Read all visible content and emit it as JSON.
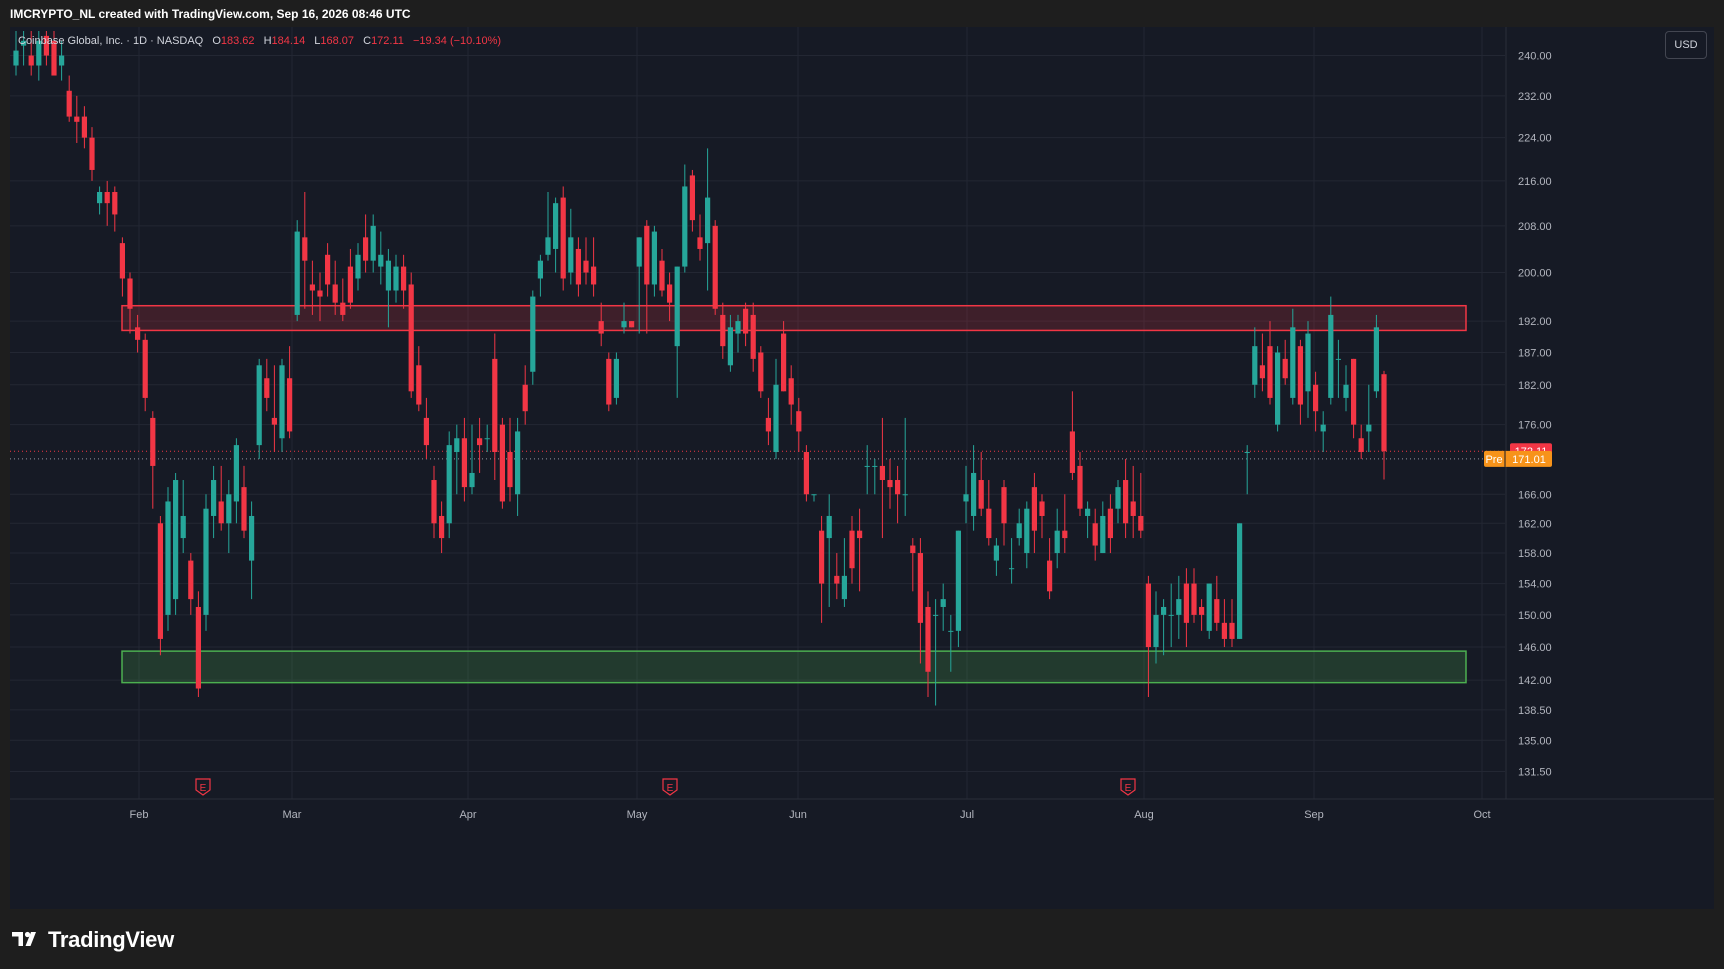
{
  "header": {
    "credit": "IMCRYPTO_NL created with TradingView.com, Sep 16, 2026 08:46 UTC"
  },
  "legend": {
    "symbol": "Coinbase Global, Inc. · 1D · NASDAQ",
    "open_label": "O",
    "open_value": "183.62",
    "high_label": "H",
    "high_value": "184.14",
    "low_label": "L",
    "low_value": "168.07",
    "close_label": "C",
    "close_value": "172.11",
    "change": "−19.34 (−10.10%)"
  },
  "currency_button": "USD",
  "price_tags": {
    "last_price": "172.11",
    "pre_label": "Pre",
    "pre_price": "171.01"
  },
  "footer": {
    "brand": "TradingView"
  },
  "colors": {
    "up": "#26a69a",
    "down": "#f23645",
    "background": "#161a25",
    "resistance_zone": "#f23645",
    "support_zone": "#4caf50",
    "pre_tag": "#f7931a"
  },
  "chart_data": {
    "type": "candlestick",
    "x_tick_labels": [
      "Feb",
      "Mar",
      "Apr",
      "May",
      "Jun",
      "Jul",
      "Aug",
      "Sep",
      "Oct"
    ],
    "y_tick_labels": [
      "240.00",
      "232.00",
      "224.00",
      "216.00",
      "208.00",
      "200.00",
      "192.00",
      "187.00",
      "182.00",
      "176.00",
      "166.00",
      "162.00",
      "158.00",
      "154.00",
      "150.00",
      "146.00",
      "142.00",
      "138.50",
      "135.00",
      "131.50"
    ],
    "y_scale": "log",
    "ylim": [
      128.5,
      245
    ],
    "zones": [
      {
        "kind": "resistance",
        "from": "Feb",
        "to": "Sep",
        "low": 190.5,
        "high": 194.5
      },
      {
        "kind": "support",
        "from": "Feb",
        "to": "Sep",
        "low": 141.7,
        "high": 145.5
      }
    ],
    "earnings_markers": [
      "Feb",
      "May",
      "Aug"
    ],
    "earnings_marker_label": "E",
    "last_close": 172.11,
    "premarket": 171.01,
    "candles": [
      {
        "o": 238,
        "h": 245,
        "l": 236,
        "c": 241
      },
      {
        "o": 242,
        "h": 245,
        "l": 238,
        "c": 243
      },
      {
        "o": 240,
        "h": 245,
        "l": 236,
        "c": 238
      },
      {
        "o": 238,
        "h": 245,
        "l": 235,
        "c": 243
      },
      {
        "o": 244,
        "h": 245,
        "l": 238,
        "c": 240
      },
      {
        "o": 243,
        "h": 245,
        "l": 236,
        "c": 236
      },
      {
        "o": 238,
        "h": 243,
        "l": 235,
        "c": 240
      },
      {
        "o": 233,
        "h": 236,
        "l": 227,
        "c": 228
      },
      {
        "o": 228,
        "h": 232,
        "l": 223,
        "c": 227
      },
      {
        "o": 228,
        "h": 230,
        "l": 222,
        "c": 224
      },
      {
        "o": 224,
        "h": 226,
        "l": 216,
        "c": 218
      },
      {
        "o": 212,
        "h": 215,
        "l": 210,
        "c": 214
      },
      {
        "o": 214,
        "h": 216,
        "l": 208,
        "c": 212
      },
      {
        "o": 214,
        "h": 215,
        "l": 207,
        "c": 210
      },
      {
        "o": 205,
        "h": 206,
        "l": 196,
        "c": 199
      },
      {
        "o": 199,
        "h": 200,
        "l": 190,
        "c": 194
      },
      {
        "o": 191,
        "h": 193,
        "l": 187,
        "c": 189
      },
      {
        "o": 189,
        "h": 190,
        "l": 178,
        "c": 180
      },
      {
        "o": 177,
        "h": 178,
        "l": 164,
        "c": 170
      },
      {
        "o": 162,
        "h": 163,
        "l": 145,
        "c": 147
      },
      {
        "o": 150,
        "h": 167,
        "l": 148,
        "c": 165
      },
      {
        "o": 152,
        "h": 169,
        "l": 150,
        "c": 168
      },
      {
        "o": 160,
        "h": 168,
        "l": 158,
        "c": 163
      },
      {
        "o": 157,
        "h": 158,
        "l": 150,
        "c": 152
      },
      {
        "o": 151,
        "h": 153,
        "l": 140,
        "c": 141
      },
      {
        "o": 150,
        "h": 166,
        "l": 148,
        "c": 164
      },
      {
        "o": 163,
        "h": 170,
        "l": 160,
        "c": 168
      },
      {
        "o": 165,
        "h": 170,
        "l": 161,
        "c": 162
      },
      {
        "o": 162,
        "h": 168,
        "l": 158,
        "c": 166
      },
      {
        "o": 165,
        "h": 174,
        "l": 162,
        "c": 173
      },
      {
        "o": 167,
        "h": 170,
        "l": 160,
        "c": 161
      },
      {
        "o": 157,
        "h": 165,
        "l": 152,
        "c": 163
      },
      {
        "o": 173,
        "h": 186,
        "l": 171,
        "c": 185
      },
      {
        "o": 183,
        "h": 186,
        "l": 178,
        "c": 180
      },
      {
        "o": 177,
        "h": 185,
        "l": 172,
        "c": 176
      },
      {
        "o": 174,
        "h": 186,
        "l": 172,
        "c": 185
      },
      {
        "o": 183,
        "h": 188,
        "l": 174,
        "c": 175
      },
      {
        "o": 193,
        "h": 209,
        "l": 192,
        "c": 207
      },
      {
        "o": 206,
        "h": 214,
        "l": 194,
        "c": 202
      },
      {
        "o": 198,
        "h": 202,
        "l": 193,
        "c": 197
      },
      {
        "o": 197,
        "h": 200,
        "l": 192,
        "c": 196
      },
      {
        "o": 203,
        "h": 205,
        "l": 196,
        "c": 198
      },
      {
        "o": 198,
        "h": 202,
        "l": 193,
        "c": 195
      },
      {
        "o": 195,
        "h": 199,
        "l": 192,
        "c": 193
      },
      {
        "o": 201,
        "h": 204,
        "l": 194,
        "c": 195
      },
      {
        "o": 199,
        "h": 205,
        "l": 197,
        "c": 203
      },
      {
        "o": 206,
        "h": 210,
        "l": 200,
        "c": 202
      },
      {
        "o": 202,
        "h": 210,
        "l": 200,
        "c": 208
      },
      {
        "o": 201,
        "h": 207,
        "l": 198,
        "c": 203
      },
      {
        "o": 197,
        "h": 204,
        "l": 191,
        "c": 202
      },
      {
        "o": 197,
        "h": 203,
        "l": 195,
        "c": 201
      },
      {
        "o": 201,
        "h": 203,
        "l": 194,
        "c": 197
      },
      {
        "o": 198,
        "h": 200,
        "l": 180,
        "c": 181
      },
      {
        "o": 185,
        "h": 188,
        "l": 178,
        "c": 179
      },
      {
        "o": 177,
        "h": 180,
        "l": 171,
        "c": 173
      },
      {
        "o": 168,
        "h": 170,
        "l": 160,
        "c": 162
      },
      {
        "o": 163,
        "h": 165,
        "l": 158,
        "c": 160
      },
      {
        "o": 162,
        "h": 175,
        "l": 160,
        "c": 173
      },
      {
        "o": 172,
        "h": 176,
        "l": 166,
        "c": 174
      },
      {
        "o": 174,
        "h": 177,
        "l": 165,
        "c": 167
      },
      {
        "o": 167,
        "h": 176,
        "l": 166,
        "c": 169
      },
      {
        "o": 174,
        "h": 177,
        "l": 169,
        "c": 173
      },
      {
        "o": 174,
        "h": 176,
        "l": 172,
        "c": 174
      },
      {
        "o": 186,
        "h": 190,
        "l": 168,
        "c": 172
      },
      {
        "o": 176,
        "h": 177,
        "l": 164,
        "c": 165
      },
      {
        "o": 172,
        "h": 177,
        "l": 165,
        "c": 167
      },
      {
        "o": 166,
        "h": 177,
        "l": 163,
        "c": 175
      },
      {
        "o": 182,
        "h": 185,
        "l": 176,
        "c": 178
      },
      {
        "o": 184,
        "h": 197,
        "l": 182,
        "c": 196
      },
      {
        "o": 199,
        "h": 203,
        "l": 196,
        "c": 202
      },
      {
        "o": 203,
        "h": 214,
        "l": 202,
        "c": 206
      },
      {
        "o": 204,
        "h": 213,
        "l": 200,
        "c": 212
      },
      {
        "o": 213,
        "h": 215,
        "l": 197,
        "c": 199
      },
      {
        "o": 200,
        "h": 211,
        "l": 198,
        "c": 206
      },
      {
        "o": 204,
        "h": 206,
        "l": 196,
        "c": 198
      },
      {
        "o": 202,
        "h": 206,
        "l": 198,
        "c": 200
      },
      {
        "o": 201,
        "h": 206,
        "l": 196,
        "c": 198
      },
      {
        "o": 192,
        "h": 195,
        "l": 188,
        "c": 190
      },
      {
        "o": 186,
        "h": 187,
        "l": 178,
        "c": 179
      },
      {
        "o": 180,
        "h": 187,
        "l": 179,
        "c": 186
      },
      {
        "o": 191,
        "h": 195,
        "l": 190,
        "c": 192
      },
      {
        "o": 192,
        "h": 192,
        "l": 191,
        "c": 191
      },
      {
        "o": 201,
        "h": 206,
        "l": 190,
        "c": 206
      },
      {
        "o": 208,
        "h": 209,
        "l": 190,
        "c": 198
      },
      {
        "o": 198,
        "h": 208,
        "l": 196,
        "c": 207
      },
      {
        "o": 202,
        "h": 204,
        "l": 196,
        "c": 197
      },
      {
        "o": 198,
        "h": 200,
        "l": 192,
        "c": 195
      },
      {
        "o": 188,
        "h": 201,
        "l": 180,
        "c": 201
      },
      {
        "o": 201,
        "h": 219,
        "l": 200,
        "c": 215
      },
      {
        "o": 217,
        "h": 218,
        "l": 207,
        "c": 209
      },
      {
        "o": 206,
        "h": 210,
        "l": 202,
        "c": 204
      },
      {
        "o": 205,
        "h": 222,
        "l": 197,
        "c": 213
      },
      {
        "o": 208,
        "h": 209,
        "l": 193,
        "c": 194
      },
      {
        "o": 193,
        "h": 195,
        "l": 186,
        "c": 188
      },
      {
        "o": 185,
        "h": 193,
        "l": 184,
        "c": 191
      },
      {
        "o": 190,
        "h": 193,
        "l": 187,
        "c": 192
      },
      {
        "o": 194,
        "h": 195,
        "l": 188,
        "c": 190
      },
      {
        "o": 193,
        "h": 195,
        "l": 184,
        "c": 186
      },
      {
        "o": 187,
        "h": 188,
        "l": 180,
        "c": 181
      },
      {
        "o": 177,
        "h": 180,
        "l": 173,
        "c": 175
      },
      {
        "o": 172,
        "h": 186,
        "l": 171,
        "c": 182
      },
      {
        "o": 190,
        "h": 192,
        "l": 181,
        "c": 181
      },
      {
        "o": 183,
        "h": 185,
        "l": 176,
        "c": 179
      },
      {
        "o": 178,
        "h": 180,
        "l": 172,
        "c": 175
      },
      {
        "o": 172,
        "h": 173,
        "l": 165,
        "c": 166
      },
      {
        "o": 166,
        "h": 166,
        "l": 165,
        "c": 166
      },
      {
        "o": 161,
        "h": 163,
        "l": 149,
        "c": 154
      },
      {
        "o": 160,
        "h": 166,
        "l": 151,
        "c": 163
      },
      {
        "o": 155,
        "h": 158,
        "l": 152,
        "c": 154
      },
      {
        "o": 152,
        "h": 160,
        "l": 151,
        "c": 155
      },
      {
        "o": 161,
        "h": 163,
        "l": 154,
        "c": 156
      },
      {
        "o": 161,
        "h": 164,
        "l": 153,
        "c": 160
      },
      {
        "o": 170,
        "h": 173,
        "l": 166,
        "c": 170
      },
      {
        "o": 170,
        "h": 171,
        "l": 166,
        "c": 170
      },
      {
        "o": 170,
        "h": 177,
        "l": 160,
        "c": 168
      },
      {
        "o": 168,
        "h": 171,
        "l": 164,
        "c": 167
      },
      {
        "o": 168,
        "h": 170,
        "l": 162,
        "c": 166
      },
      {
        "o": 166,
        "h": 177,
        "l": 163,
        "c": 166
      },
      {
        "o": 159,
        "h": 160,
        "l": 153,
        "c": 158
      },
      {
        "o": 158,
        "h": 160,
        "l": 144,
        "c": 149
      },
      {
        "o": 151,
        "h": 153,
        "l": 140,
        "c": 143
      },
      {
        "o": 150,
        "h": 152,
        "l": 139,
        "c": 150
      },
      {
        "o": 151,
        "h": 154,
        "l": 148,
        "c": 152
      },
      {
        "o": 148,
        "h": 150,
        "l": 143,
        "c": 148
      },
      {
        "o": 148,
        "h": 161,
        "l": 146,
        "c": 161
      },
      {
        "o": 165,
        "h": 170,
        "l": 162,
        "c": 166
      },
      {
        "o": 163,
        "h": 173,
        "l": 161,
        "c": 169
      },
      {
        "o": 168,
        "h": 172,
        "l": 163,
        "c": 164
      },
      {
        "o": 164,
        "h": 168,
        "l": 159,
        "c": 160
      },
      {
        "o": 157,
        "h": 160,
        "l": 155,
        "c": 159
      },
      {
        "o": 167,
        "h": 168,
        "l": 159,
        "c": 162
      },
      {
        "o": 156,
        "h": 160,
        "l": 154,
        "c": 156
      },
      {
        "o": 160,
        "h": 164,
        "l": 159,
        "c": 162
      },
      {
        "o": 158,
        "h": 165,
        "l": 156,
        "c": 164
      },
      {
        "o": 167,
        "h": 169,
        "l": 158,
        "c": 161
      },
      {
        "o": 165,
        "h": 166,
        "l": 160,
        "c": 163
      },
      {
        "o": 157,
        "h": 160,
        "l": 152,
        "c": 153
      },
      {
        "o": 158,
        "h": 164,
        "l": 156,
        "c": 161
      },
      {
        "o": 161,
        "h": 166,
        "l": 158,
        "c": 160
      },
      {
        "o": 175,
        "h": 181,
        "l": 168,
        "c": 169
      },
      {
        "o": 170,
        "h": 172,
        "l": 163,
        "c": 164
      },
      {
        "o": 163,
        "h": 165,
        "l": 160,
        "c": 164
      },
      {
        "o": 162,
        "h": 164,
        "l": 157,
        "c": 159
      },
      {
        "o": 158,
        "h": 165,
        "l": 158,
        "c": 163
      },
      {
        "o": 164,
        "h": 166,
        "l": 158,
        "c": 160
      },
      {
        "o": 164,
        "h": 168,
        "l": 162,
        "c": 167
      },
      {
        "o": 168,
        "h": 171,
        "l": 160,
        "c": 162
      },
      {
        "o": 165,
        "h": 170,
        "l": 160,
        "c": 163
      },
      {
        "o": 163,
        "h": 169,
        "l": 160,
        "c": 161
      },
      {
        "o": 154,
        "h": 155,
        "l": 140,
        "c": 146
      },
      {
        "o": 146,
        "h": 153,
        "l": 144,
        "c": 150
      },
      {
        "o": 150,
        "h": 152,
        "l": 145,
        "c": 151
      },
      {
        "o": 150,
        "h": 154,
        "l": 146,
        "c": 150
      },
      {
        "o": 150,
        "h": 155,
        "l": 147,
        "c": 152
      },
      {
        "o": 154,
        "h": 156,
        "l": 146,
        "c": 149
      },
      {
        "o": 154,
        "h": 156,
        "l": 149,
        "c": 150
      },
      {
        "o": 151,
        "h": 152,
        "l": 148,
        "c": 150
      },
      {
        "o": 148,
        "h": 154,
        "l": 147,
        "c": 154
      },
      {
        "o": 152,
        "h": 155,
        "l": 148,
        "c": 149
      },
      {
        "o": 149,
        "h": 152,
        "l": 146,
        "c": 147
      },
      {
        "o": 149,
        "h": 152,
        "l": 146,
        "c": 147
      },
      {
        "o": 147,
        "h": 162,
        "l": 147,
        "c": 162
      },
      {
        "o": 172,
        "h": 173,
        "l": 166,
        "c": 172
      },
      {
        "o": 182,
        "h": 191,
        "l": 180,
        "c": 188
      },
      {
        "o": 185,
        "h": 190,
        "l": 181,
        "c": 183
      },
      {
        "o": 188,
        "h": 192,
        "l": 179,
        "c": 180
      },
      {
        "o": 176,
        "h": 188,
        "l": 175,
        "c": 187
      },
      {
        "o": 186,
        "h": 189,
        "l": 182,
        "c": 183
      },
      {
        "o": 180,
        "h": 194,
        "l": 179,
        "c": 191
      },
      {
        "o": 188,
        "h": 189,
        "l": 176,
        "c": 179
      },
      {
        "o": 181,
        "h": 192,
        "l": 177,
        "c": 190
      },
      {
        "o": 182,
        "h": 184,
        "l": 175,
        "c": 178
      },
      {
        "o": 175,
        "h": 178,
        "l": 172,
        "c": 176
      },
      {
        "o": 180,
        "h": 196,
        "l": 179,
        "c": 193
      },
      {
        "o": 186,
        "h": 189,
        "l": 180,
        "c": 186
      },
      {
        "o": 180,
        "h": 185,
        "l": 178,
        "c": 182
      },
      {
        "o": 186,
        "h": 186,
        "l": 174,
        "c": 176
      },
      {
        "o": 174,
        "h": 176,
        "l": 171,
        "c": 172
      },
      {
        "o": 175,
        "h": 182,
        "l": 172,
        "c": 176
      },
      {
        "o": 181,
        "h": 193,
        "l": 180,
        "c": 191
      },
      {
        "o": 183.62,
        "h": 184.14,
        "l": 168.07,
        "c": 172.11
      }
    ]
  }
}
